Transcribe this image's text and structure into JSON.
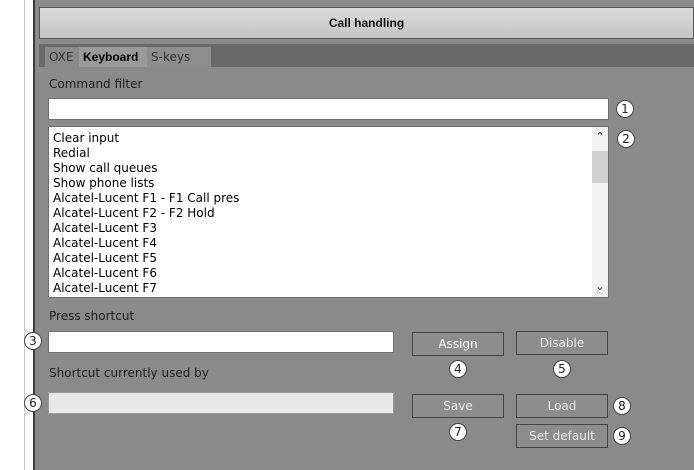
{
  "window": {
    "title": "Call handling"
  },
  "tabs": [
    "OXE",
    "Keyboard",
    "S-keys"
  ],
  "command_filter": {
    "label": "Command filter",
    "value": ""
  },
  "commands": [
    "Clear input",
    "Redial",
    "Show call queues",
    "Show phone lists",
    "Alcatel-Lucent F1 - F1 Call pres",
    "Alcatel-Lucent F2 - F2 Hold",
    "Alcatel-Lucent F3",
    "Alcatel-Lucent F4",
    "Alcatel-Lucent F5",
    "Alcatel-Lucent F6",
    "Alcatel-Lucent F7"
  ],
  "scroll_icons": {
    "up": "chevron-up-icon",
    "down": "chevron-down-icon"
  },
  "press_shortcut": {
    "label": "Press shortcut",
    "value": ""
  },
  "shortcut_used_by": {
    "label": "Shortcut currently used by",
    "value": ""
  },
  "buttons": {
    "assign": "Assign",
    "disable": "Disable",
    "save": "Save",
    "load": "Load",
    "set_default": "Set default"
  },
  "callouts": [
    "1",
    "2",
    "3",
    "4",
    "5",
    "6",
    "7",
    "8",
    "9"
  ]
}
